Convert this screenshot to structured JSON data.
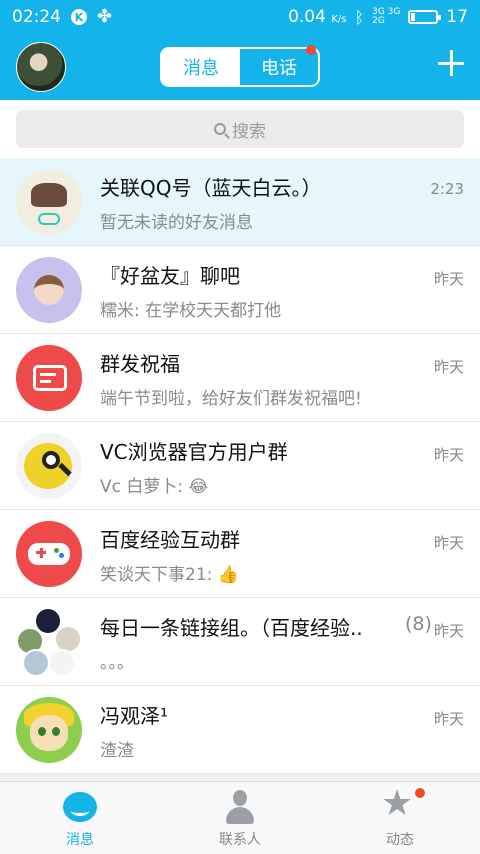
{
  "status_bar": {
    "time": "02:24",
    "speed": "0.04",
    "speed_unit": "K/s",
    "network": [
      "3G 3G",
      "2G"
    ],
    "battery_level": 17,
    "battery": "17"
  },
  "header": {
    "tabs": [
      {
        "label": "消息",
        "active": true
      },
      {
        "label": "电话",
        "active": false,
        "badge": true
      }
    ]
  },
  "search": {
    "placeholder": "搜索"
  },
  "conversations": [
    {
      "name": "关联QQ号（蓝天白云。）",
      "message": "暂无未读的好友消息",
      "time": "2:23",
      "highlighted": true
    },
    {
      "name": "『好盆友』聊吧",
      "message": "糯米: 在学校天天都打他",
      "time": "昨天"
    },
    {
      "name": "群发祝福",
      "message": "端午节到啦，给好友们群发祝福吧!",
      "time": "昨天"
    },
    {
      "name": "VC浏览器官方用户群",
      "message": "Vc 白萝卜: 😂",
      "time": "昨天"
    },
    {
      "name": "百度经验互动群",
      "message": "笑谈天下事21: 👍",
      "time": "昨天"
    },
    {
      "name": "每日一条链接组。（百度经验..",
      "count": "(8)",
      "message": "。。。",
      "time": "昨天"
    },
    {
      "name": "冯观泽¹",
      "message": "渣渣",
      "time": "昨天"
    }
  ],
  "tabbar": {
    "items": [
      {
        "label": "消息",
        "icon": "chat-bubble-icon",
        "active": true
      },
      {
        "label": "联系人",
        "icon": "contact-person-icon",
        "active": false
      },
      {
        "label": "动态",
        "icon": "star-icon",
        "active": false,
        "badge": true
      }
    ]
  },
  "colors": {
    "accent": "#14b4ea",
    "badge": "#f24a2a"
  }
}
